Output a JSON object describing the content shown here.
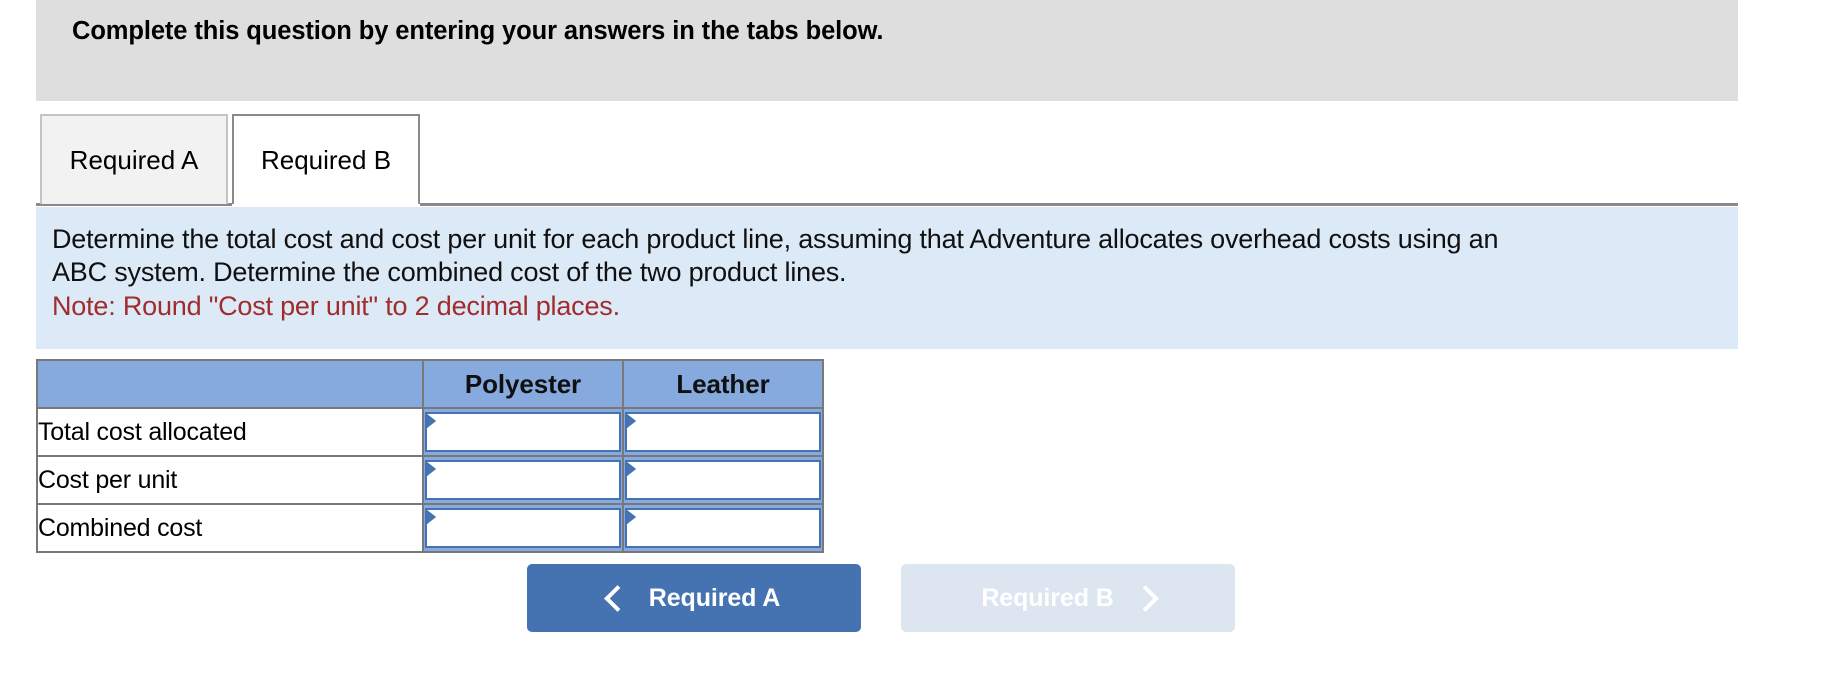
{
  "banner": {
    "title": "Complete this question by entering your answers in the tabs below."
  },
  "tabs": [
    {
      "label": "Required A",
      "active": false
    },
    {
      "label": "Required B",
      "active": true
    }
  ],
  "instructions": {
    "line1": "Determine the total cost and cost per unit for each product line, assuming that Adventure allocates overhead costs using an",
    "line2": "ABC system. Determine the combined cost of the two product lines.",
    "note": "Note: Round \"Cost per unit\" to 2 decimal places."
  },
  "table": {
    "headers": [
      "",
      "Polyester",
      "Leather"
    ],
    "rows": [
      {
        "label": "Total cost allocated",
        "polyester": "",
        "leather": ""
      },
      {
        "label": "Cost per unit",
        "polyester": "",
        "leather": ""
      },
      {
        "label": "Combined cost",
        "polyester": "",
        "leather": ""
      }
    ]
  },
  "navigation": {
    "prev_label": "Required A",
    "next_label": "Required B",
    "prev_icon": "chevron-left-icon",
    "next_icon": "chevron-right-icon"
  },
  "colors": {
    "banner_bg": "#dedede",
    "instructions_bg": "#dce9f7",
    "note_text": "#a02c2c",
    "table_header_bg": "#86aadd",
    "input_border": "#4572b0",
    "button_active_bg": "#4572b0",
    "button_disabled_bg": "#dce5f0"
  }
}
